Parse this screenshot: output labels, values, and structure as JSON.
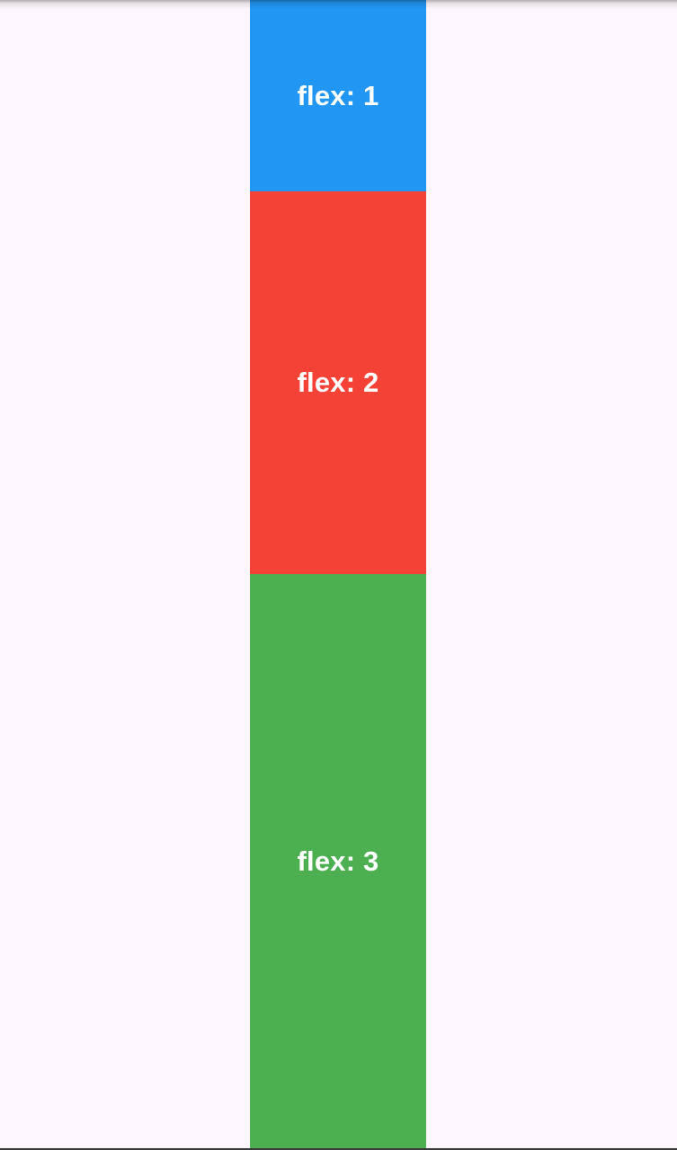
{
  "boxes": [
    {
      "label": "flex: 1",
      "flex": 1,
      "color": "#2196f3"
    },
    {
      "label": "flex: 2",
      "flex": 2,
      "color": "#f44336"
    },
    {
      "label": "flex: 3",
      "flex": 3,
      "color": "#4caf50"
    }
  ],
  "colors": {
    "background": "#fdf7fd",
    "text": "#ffffff"
  }
}
